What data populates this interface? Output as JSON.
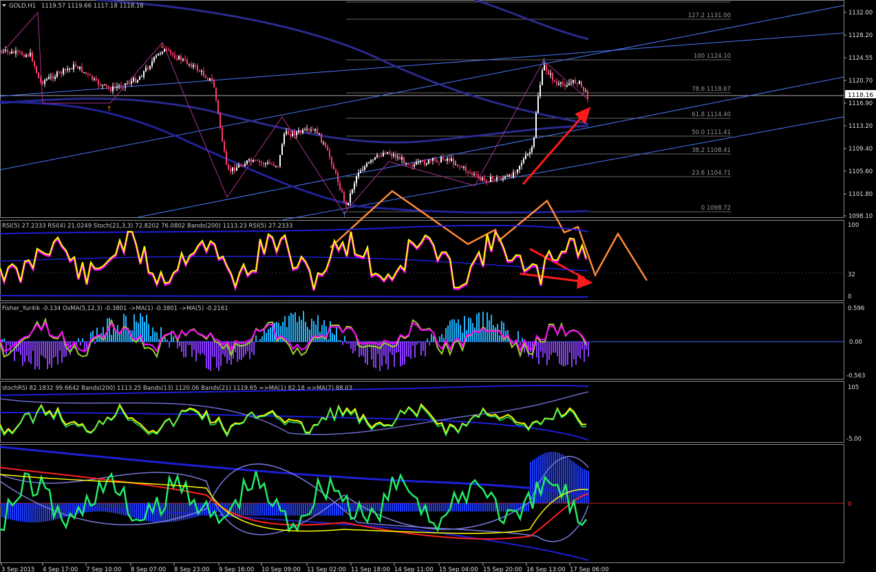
{
  "header": {
    "symbol": "GOLD,H1",
    "ohlc": "1119.57 1119.66 1117.18 1118.16"
  },
  "price_axis": {
    "ticks": [
      "1132.00",
      "1128.20",
      "1124.55",
      "1120.70",
      "1116.90",
      "1113.20",
      "1109.40",
      "1105.60",
      "1101.80",
      "1098.10"
    ],
    "current_price": "1118.16"
  },
  "fib_levels": [
    {
      "label": "127.2 1131.00"
    },
    {
      "label": "100 1124.10"
    },
    {
      "label": "78.6 1118.67"
    },
    {
      "label": "61.8 1114.40"
    },
    {
      "label": "50.0 1111.41"
    },
    {
      "label": "38.2 1108.41"
    },
    {
      "label": "23.6 1104.71"
    },
    {
      "label": "0 1098.72"
    }
  ],
  "time_axis": [
    "3 Sep 2015",
    "4 Sep 17:00",
    "7 Sep 10:00",
    "8 Sep 07:00",
    "8 Sep 23:00",
    "9 Sep 16:00",
    "10 Sep 09:00",
    "11 Sep 02:00",
    "11 Sep 18:00",
    "14 Sep 11:00",
    "15 Sep 04:00",
    "15 Sep 20:00",
    "16 Sep 13:00",
    "17 Sep 06:00"
  ],
  "panes": {
    "rsi": {
      "title": "RSI(5) 27.2333  RSI(4) 21.0249  Stoch(21,3,3) 72.8202 76.0802  Bands(200) 1113.23  RSI(5) 27.2333",
      "ticks": [
        "100",
        "32",
        "0"
      ]
    },
    "fisher": {
      "title": "Fisher_Yur4ik -0.134  OsMA(5,12,3) -0.3801  ->MA(1) -0.3801  ->MA(5) -0.2161",
      "ticks": [
        "0.596",
        "0.00",
        "-0.563"
      ]
    },
    "stochrsi": {
      "title": "stochRSI 82.1832 99.6642  Bands(200) 1113.25  Bands(13) 1120.06  Bands(21) 1119.65  =>MA(1) 82.18  =>MA(7) 88.03",
      "ticks": [
        "105",
        "-5.00"
      ]
    },
    "bottom": {
      "ticks": [
        "0"
      ]
    }
  },
  "colors": {
    "background": "#000000",
    "bull_candle": "#ffffff",
    "bear_candle": "#ff3c6e",
    "channel": "#4a7bff",
    "ma_dark": "#2a2a8c",
    "arrow_orange": "#ff8c3a",
    "arrow_red": "#ff1a1a",
    "rsi_yellow": "#ffff00",
    "rsi_magenta": "#ff00ff",
    "fisher_cyan": "#1fb4ff",
    "osma_purple": "#8a3cff",
    "green_line": "#22ee66",
    "baseline_blue": "#3a6cff"
  },
  "chart_data": {
    "type": "line",
    "title": "GOLD,H1",
    "series": [
      {
        "name": "GOLD,H1",
        "x": [
          "3 Sep 2015",
          "4 Sep 17:00",
          "7 Sep 10:00",
          "8 Sep 07:00",
          "8 Sep 23:00",
          "9 Sep 16:00",
          "10 Sep 09:00",
          "11 Sep 02:00",
          "11 Sep 18:00",
          "14 Sep 11:00",
          "15 Sep 04:00",
          "15 Sep 20:00",
          "16 Sep 13:00",
          "17 Sep 06:00"
        ],
        "values": [
          1125.5,
          1121.0,
          1119.5,
          1122.0,
          1120.5,
          1103.5,
          1108.5,
          1103.0,
          1108.5,
          1107.5,
          1106.0,
          1106.5,
          1121.5,
          1117.5
        ]
      }
    ],
    "ylim": [
      1097.0,
      1133.5
    ]
  }
}
